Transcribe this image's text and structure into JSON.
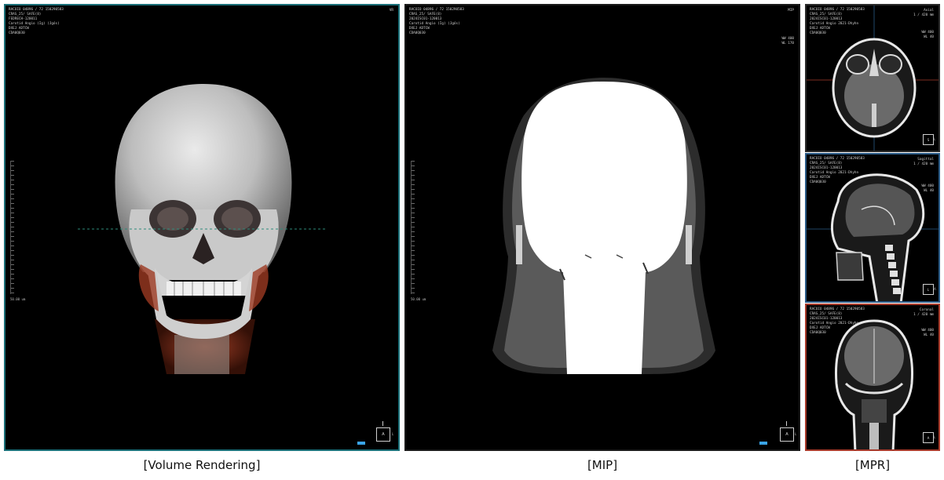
{
  "captions": {
    "vr": "[Volume Rendering]",
    "mip": "[MIP]",
    "mpr": "[MPR]"
  },
  "vr": {
    "overlay_left": "RACOIO 04896 / 72 150290583\nCRAS_25/ SAFE(8)\nFEDRECH-120011\nCarotid Angio (Ig) (Jgós)\nDXEJ ADTCW\nCDA0Q030",
    "overlay_right": "VR",
    "ruler_label": "50.00 um",
    "orient": "A",
    "orient_side": "L"
  },
  "mip": {
    "overlay_left": "RACOIO 04896 / 72 150290583\nCRAS_25/ SAFE(8)\n2024ISC01-120013\nCarotid Angio (Ig) (Jgós)\nDXEJ ADTCW\nCDA0Q030",
    "overlay_right": "MIP",
    "wl": "WW 400\nWL 170",
    "ruler_label": "50.00 um",
    "orient": "A",
    "orient_side": "L"
  },
  "axial": {
    "overlay_left": "RACOIO 04896 / 72 150290583\nCRAS_25/ SAFE(8)\n2024ISC01-120013\nCarotid Angio 2021-Dhyhn\nDXEJ ADTCW\nCDA0Q030",
    "overlay_right": "Axial\n1 / 420 mm",
    "wl": "WW 400\nWL 40",
    "orient": "S",
    "orient_side": "L"
  },
  "sagittal": {
    "overlay_left": "RACOIO 04896 / 72 150290583\nCRAS_25/ SAFE(8)\n2024ISC01-120013\nCarotid Angio 2021-Dhyhn\nDXEJ ADTCW\nCDA0Q030",
    "overlay_right": "Sagittal\n1 / 420 mm",
    "wl": "WW 400\nWL 40",
    "orient": "L",
    "orient_side": "A"
  },
  "coronal": {
    "overlay_left": "RACOIO 04896 / 72 150290583\nCRAS_25/ SAFE(8)\n2024ISC01-120013\nCarotid Angio 2021-Dhyhn\nDXEJ ADTCW\nCDA0Q030",
    "overlay_right": "Coronal\n1 / 420 mm",
    "wl": "WW 400\nWL 40",
    "orient": "A",
    "orient_side": "L"
  }
}
